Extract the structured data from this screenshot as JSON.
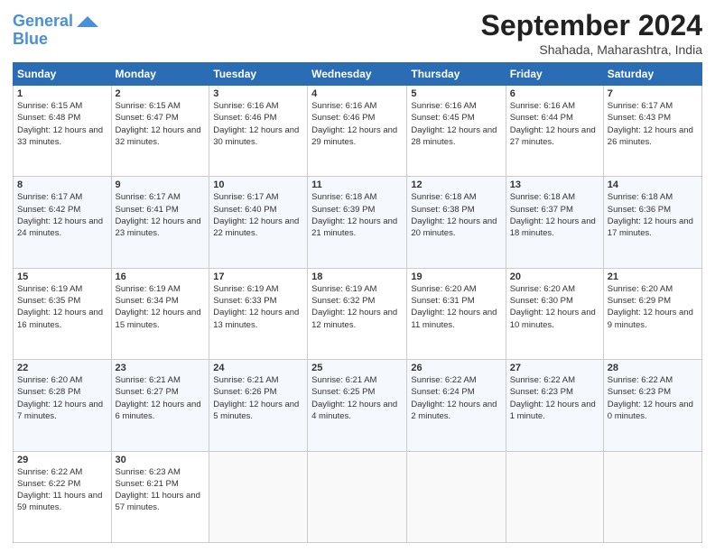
{
  "logo": {
    "line1": "General",
    "line2": "Blue"
  },
  "header": {
    "month": "September 2024",
    "location": "Shahada, Maharashtra, India"
  },
  "weekdays": [
    "Sunday",
    "Monday",
    "Tuesday",
    "Wednesday",
    "Thursday",
    "Friday",
    "Saturday"
  ],
  "weeks": [
    [
      {
        "day": "1",
        "sunrise": "Sunrise: 6:15 AM",
        "sunset": "Sunset: 6:48 PM",
        "daylight": "Daylight: 12 hours and 33 minutes."
      },
      {
        "day": "2",
        "sunrise": "Sunrise: 6:15 AM",
        "sunset": "Sunset: 6:47 PM",
        "daylight": "Daylight: 12 hours and 32 minutes."
      },
      {
        "day": "3",
        "sunrise": "Sunrise: 6:16 AM",
        "sunset": "Sunset: 6:46 PM",
        "daylight": "Daylight: 12 hours and 30 minutes."
      },
      {
        "day": "4",
        "sunrise": "Sunrise: 6:16 AM",
        "sunset": "Sunset: 6:46 PM",
        "daylight": "Daylight: 12 hours and 29 minutes."
      },
      {
        "day": "5",
        "sunrise": "Sunrise: 6:16 AM",
        "sunset": "Sunset: 6:45 PM",
        "daylight": "Daylight: 12 hours and 28 minutes."
      },
      {
        "day": "6",
        "sunrise": "Sunrise: 6:16 AM",
        "sunset": "Sunset: 6:44 PM",
        "daylight": "Daylight: 12 hours and 27 minutes."
      },
      {
        "day": "7",
        "sunrise": "Sunrise: 6:17 AM",
        "sunset": "Sunset: 6:43 PM",
        "daylight": "Daylight: 12 hours and 26 minutes."
      }
    ],
    [
      {
        "day": "8",
        "sunrise": "Sunrise: 6:17 AM",
        "sunset": "Sunset: 6:42 PM",
        "daylight": "Daylight: 12 hours and 24 minutes."
      },
      {
        "day": "9",
        "sunrise": "Sunrise: 6:17 AM",
        "sunset": "Sunset: 6:41 PM",
        "daylight": "Daylight: 12 hours and 23 minutes."
      },
      {
        "day": "10",
        "sunrise": "Sunrise: 6:17 AM",
        "sunset": "Sunset: 6:40 PM",
        "daylight": "Daylight: 12 hours and 22 minutes."
      },
      {
        "day": "11",
        "sunrise": "Sunrise: 6:18 AM",
        "sunset": "Sunset: 6:39 PM",
        "daylight": "Daylight: 12 hours and 21 minutes."
      },
      {
        "day": "12",
        "sunrise": "Sunrise: 6:18 AM",
        "sunset": "Sunset: 6:38 PM",
        "daylight": "Daylight: 12 hours and 20 minutes."
      },
      {
        "day": "13",
        "sunrise": "Sunrise: 6:18 AM",
        "sunset": "Sunset: 6:37 PM",
        "daylight": "Daylight: 12 hours and 18 minutes."
      },
      {
        "day": "14",
        "sunrise": "Sunrise: 6:18 AM",
        "sunset": "Sunset: 6:36 PM",
        "daylight": "Daylight: 12 hours and 17 minutes."
      }
    ],
    [
      {
        "day": "15",
        "sunrise": "Sunrise: 6:19 AM",
        "sunset": "Sunset: 6:35 PM",
        "daylight": "Daylight: 12 hours and 16 minutes."
      },
      {
        "day": "16",
        "sunrise": "Sunrise: 6:19 AM",
        "sunset": "Sunset: 6:34 PM",
        "daylight": "Daylight: 12 hours and 15 minutes."
      },
      {
        "day": "17",
        "sunrise": "Sunrise: 6:19 AM",
        "sunset": "Sunset: 6:33 PM",
        "daylight": "Daylight: 12 hours and 13 minutes."
      },
      {
        "day": "18",
        "sunrise": "Sunrise: 6:19 AM",
        "sunset": "Sunset: 6:32 PM",
        "daylight": "Daylight: 12 hours and 12 minutes."
      },
      {
        "day": "19",
        "sunrise": "Sunrise: 6:20 AM",
        "sunset": "Sunset: 6:31 PM",
        "daylight": "Daylight: 12 hours and 11 minutes."
      },
      {
        "day": "20",
        "sunrise": "Sunrise: 6:20 AM",
        "sunset": "Sunset: 6:30 PM",
        "daylight": "Daylight: 12 hours and 10 minutes."
      },
      {
        "day": "21",
        "sunrise": "Sunrise: 6:20 AM",
        "sunset": "Sunset: 6:29 PM",
        "daylight": "Daylight: 12 hours and 9 minutes."
      }
    ],
    [
      {
        "day": "22",
        "sunrise": "Sunrise: 6:20 AM",
        "sunset": "Sunset: 6:28 PM",
        "daylight": "Daylight: 12 hours and 7 minutes."
      },
      {
        "day": "23",
        "sunrise": "Sunrise: 6:21 AM",
        "sunset": "Sunset: 6:27 PM",
        "daylight": "Daylight: 12 hours and 6 minutes."
      },
      {
        "day": "24",
        "sunrise": "Sunrise: 6:21 AM",
        "sunset": "Sunset: 6:26 PM",
        "daylight": "Daylight: 12 hours and 5 minutes."
      },
      {
        "day": "25",
        "sunrise": "Sunrise: 6:21 AM",
        "sunset": "Sunset: 6:25 PM",
        "daylight": "Daylight: 12 hours and 4 minutes."
      },
      {
        "day": "26",
        "sunrise": "Sunrise: 6:22 AM",
        "sunset": "Sunset: 6:24 PM",
        "daylight": "Daylight: 12 hours and 2 minutes."
      },
      {
        "day": "27",
        "sunrise": "Sunrise: 6:22 AM",
        "sunset": "Sunset: 6:23 PM",
        "daylight": "Daylight: 12 hours and 1 minute."
      },
      {
        "day": "28",
        "sunrise": "Sunrise: 6:22 AM",
        "sunset": "Sunset: 6:23 PM",
        "daylight": "Daylight: 12 hours and 0 minutes."
      }
    ],
    [
      {
        "day": "29",
        "sunrise": "Sunrise: 6:22 AM",
        "sunset": "Sunset: 6:22 PM",
        "daylight": "Daylight: 11 hours and 59 minutes."
      },
      {
        "day": "30",
        "sunrise": "Sunrise: 6:23 AM",
        "sunset": "Sunset: 6:21 PM",
        "daylight": "Daylight: 11 hours and 57 minutes."
      },
      null,
      null,
      null,
      null,
      null
    ]
  ]
}
